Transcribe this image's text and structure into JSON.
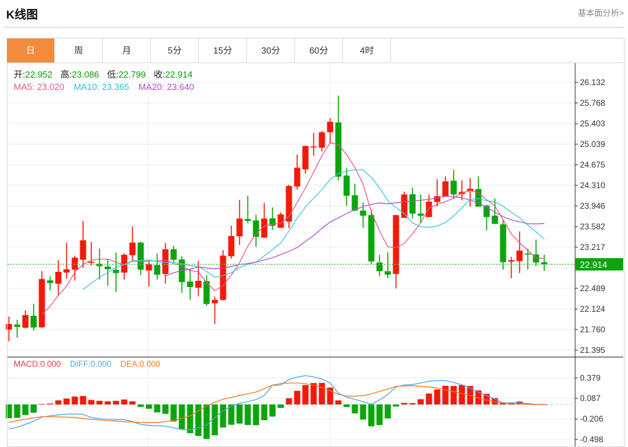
{
  "header": {
    "title": "K线图",
    "link": "基本面分析>"
  },
  "tabs": [
    {
      "label": "日",
      "active": true
    },
    {
      "label": "周"
    },
    {
      "label": "月"
    },
    {
      "label": "5分"
    },
    {
      "label": "15分"
    },
    {
      "label": "30分"
    },
    {
      "label": "60分"
    },
    {
      "label": "4时"
    }
  ],
  "info": {
    "open_label": "开:",
    "open": "22.952",
    "high_label": "高:",
    "high": "23.086",
    "low_label": "低:",
    "low": "22.799",
    "close_label": "收:",
    "close": "22.914",
    "ma5": "MA5: 23.020",
    "ma10": "MA10: 23.365",
    "ma20": "MA20: 23.640"
  },
  "macd_info": {
    "macd": "MACD:0.000",
    "diff": "DIFF:0.000",
    "dea": "DEA:0.000"
  },
  "colors": {
    "up": "#f21a0a",
    "down": "#0aa50a",
    "ma5": "#e8578a",
    "ma10": "#3cc7dc",
    "ma20": "#b44fc8",
    "diff": "#4aa3e8",
    "dea": "#f07820",
    "accent": "#f28c3c"
  },
  "chart_data": [
    {
      "type": "candlestick",
      "ylim": [
        21.395,
        26.132
      ],
      "price_ticks": [
        "26.132",
        "25.768",
        "25.403",
        "25.039",
        "24.675",
        "24.310",
        "23.946",
        "23.582",
        "23.217",
        "22.853",
        "22.489",
        "22.124",
        "21.760",
        "21.395"
      ],
      "current_price": "22.914",
      "ma_periods": [
        5,
        10,
        20
      ],
      "ohlc": [
        [
          21.76,
          21.99,
          21.55,
          21.857
        ],
        [
          21.848,
          21.933,
          21.617,
          21.808
        ],
        [
          21.792,
          22.1,
          21.78,
          22.015
        ],
        [
          22.003,
          22.217,
          21.739,
          21.796
        ],
        [
          21.8,
          22.796,
          21.787,
          22.654
        ],
        [
          22.63,
          22.703,
          22.455,
          22.582
        ],
        [
          22.57,
          22.986,
          22.355,
          22.78
        ],
        [
          22.768,
          23.298,
          22.66,
          22.825
        ],
        [
          22.82,
          23.068,
          22.626,
          23.031
        ],
        [
          22.995,
          23.679,
          22.853,
          23.338
        ],
        [
          22.943,
          23.31,
          22.893,
          22.958
        ],
        [
          22.925,
          23.193,
          22.643,
          22.88
        ],
        [
          22.873,
          23.007,
          22.533,
          22.828
        ],
        [
          22.816,
          23.119,
          22.428,
          22.759
        ],
        [
          22.768,
          23.108,
          22.643,
          23.083
        ],
        [
          23.075,
          23.585,
          22.974,
          23.298
        ],
        [
          23.298,
          23.31,
          22.723,
          22.82
        ],
        [
          22.804,
          22.974,
          22.52,
          22.92
        ],
        [
          22.9,
          23.104,
          22.643,
          22.731
        ],
        [
          22.743,
          23.29,
          22.57,
          23.18
        ],
        [
          23.18,
          23.238,
          22.962,
          22.995
        ],
        [
          23.0,
          23.055,
          22.408,
          22.6
        ],
        [
          22.61,
          22.82,
          22.287,
          22.513
        ],
        [
          22.5,
          22.974,
          22.347,
          22.622
        ],
        [
          22.618,
          22.72,
          22.176,
          22.212
        ],
        [
          22.225,
          22.343,
          21.86,
          22.285
        ],
        [
          22.285,
          23.165,
          22.273,
          23.068
        ],
        [
          23.056,
          23.597,
          23.014,
          23.415
        ],
        [
          23.408,
          24.055,
          23.257,
          23.723
        ],
        [
          23.715,
          24.128,
          23.64,
          23.682
        ],
        [
          23.69,
          23.791,
          23.225,
          23.4
        ],
        [
          23.386,
          24.0,
          23.38,
          23.723
        ],
        [
          23.727,
          23.92,
          23.52,
          23.597
        ],
        [
          23.56,
          23.833,
          23.56,
          23.797
        ],
        [
          23.67,
          24.322,
          23.549,
          24.298
        ],
        [
          24.29,
          24.857,
          24.237,
          24.622
        ],
        [
          24.593,
          25.018,
          24.52,
          25.006
        ],
        [
          24.99,
          25.24,
          24.83,
          25.0
        ],
        [
          24.975,
          25.27,
          24.91,
          25.25
        ],
        [
          25.25,
          25.5,
          25.06,
          25.436
        ],
        [
          25.424,
          25.898,
          24.4,
          24.465
        ],
        [
          24.484,
          24.614,
          23.946,
          24.128
        ],
        [
          24.136,
          24.34,
          23.853,
          23.865
        ],
        [
          23.865,
          24.007,
          23.561,
          23.772
        ],
        [
          23.784,
          23.873,
          22.922,
          22.965
        ],
        [
          22.946,
          23.083,
          22.703,
          22.792
        ],
        [
          22.792,
          23.128,
          22.67,
          22.731
        ],
        [
          22.744,
          23.79,
          22.489,
          23.784
        ],
        [
          23.736,
          24.2,
          23.736,
          24.149
        ],
        [
          24.153,
          24.27,
          23.724,
          23.812
        ],
        [
          23.812,
          24.149,
          23.642,
          23.772
        ],
        [
          23.751,
          24.149,
          23.75,
          24.022
        ],
        [
          24.015,
          24.42,
          23.937,
          24.12
        ],
        [
          24.116,
          24.47,
          24.107,
          24.38
        ],
        [
          24.392,
          24.586,
          24.067,
          24.149
        ],
        [
          24.156,
          24.399,
          24.047,
          24.197
        ],
        [
          24.209,
          24.44,
          23.934,
          24.25
        ],
        [
          24.246,
          24.47,
          23.934,
          23.934
        ],
        [
          23.954,
          23.966,
          23.512,
          23.75
        ],
        [
          23.776,
          24.076,
          23.622,
          23.63
        ],
        [
          23.622,
          23.695,
          22.82,
          22.953
        ],
        [
          22.962,
          23.047,
          22.67,
          22.986
        ],
        [
          22.97,
          23.493,
          22.76,
          23.156
        ],
        [
          23.104,
          23.19,
          22.82,
          23.088
        ],
        [
          23.088,
          23.35,
          22.88,
          22.946
        ],
        [
          22.952,
          23.086,
          22.799,
          22.914
        ]
      ]
    },
    {
      "type": "bar+line",
      "ylim": [
        -0.498,
        0.379
      ],
      "ticks": [
        "0.379",
        "0.087",
        "-0.206",
        "-0.498"
      ],
      "macd": [
        -0.195,
        -0.19,
        -0.15,
        -0.117,
        0.005,
        0.013,
        0.058,
        0.084,
        0.113,
        0.12,
        0.065,
        0.052,
        0.045,
        0.052,
        0.071,
        0.045,
        -0.036,
        -0.062,
        -0.113,
        -0.133,
        -0.243,
        -0.35,
        -0.409,
        -0.448,
        -0.49,
        -0.438,
        -0.328,
        -0.289,
        -0.272,
        -0.292,
        -0.295,
        -0.224,
        -0.172,
        -0.049,
        0.088,
        0.195,
        0.276,
        0.305,
        0.308,
        0.24,
        0.058,
        -0.036,
        -0.127,
        -0.214,
        -0.311,
        -0.292,
        -0.198,
        -0.029,
        0.023,
        0.019,
        0.075,
        0.156,
        0.214,
        0.266,
        0.263,
        0.276,
        0.263,
        0.201,
        0.152,
        0.091,
        0.023,
        0.023,
        0.042,
        0.016,
        0.003,
        0.0
      ],
      "diff": [
        -0.347,
        -0.325,
        -0.283,
        -0.238,
        -0.179,
        -0.163,
        -0.147,
        -0.137,
        -0.134,
        -0.14,
        -0.186,
        -0.202,
        -0.212,
        -0.215,
        -0.215,
        -0.244,
        -0.283,
        -0.299,
        -0.302,
        -0.309,
        -0.331,
        -0.36,
        -0.36,
        -0.328,
        -0.293,
        -0.186,
        -0.088,
        -0.027,
        0.015,
        0.041,
        0.07,
        0.128,
        0.274,
        0.275,
        0.356,
        0.39,
        0.41,
        0.394,
        0.362,
        0.307,
        0.16,
        0.105,
        0.072,
        0.04,
        0.003,
        0.062,
        0.143,
        0.25,
        0.277,
        0.283,
        0.306,
        0.332,
        0.339,
        0.339,
        0.313,
        0.28,
        0.231,
        0.175,
        0.127,
        0.078,
        0.023,
        0.023,
        0.023,
        0.013,
        0.003,
        0.0
      ],
      "dea": [
        -0.255,
        -0.229,
        -0.21,
        -0.19,
        -0.173,
        -0.174,
        -0.176,
        -0.18,
        -0.186,
        -0.2,
        -0.212,
        -0.22,
        -0.231,
        -0.238,
        -0.244,
        -0.25,
        -0.257,
        -0.257,
        -0.257,
        -0.245,
        -0.228,
        -0.2,
        -0.163,
        -0.09,
        -0.02,
        0.032,
        0.075,
        0.1,
        0.128,
        0.15,
        0.177,
        0.225,
        0.274,
        0.298,
        0.306,
        0.306,
        0.296,
        0.276,
        0.24,
        0.195,
        0.143,
        0.12,
        0.117,
        0.127,
        0.15,
        0.185,
        0.221,
        0.257,
        0.266,
        0.266,
        0.26,
        0.25,
        0.234,
        0.208,
        0.185,
        0.153,
        0.127,
        0.094,
        0.062,
        0.036,
        0.02,
        0.013,
        0.007,
        0.003,
        0.0,
        0.0
      ]
    }
  ]
}
